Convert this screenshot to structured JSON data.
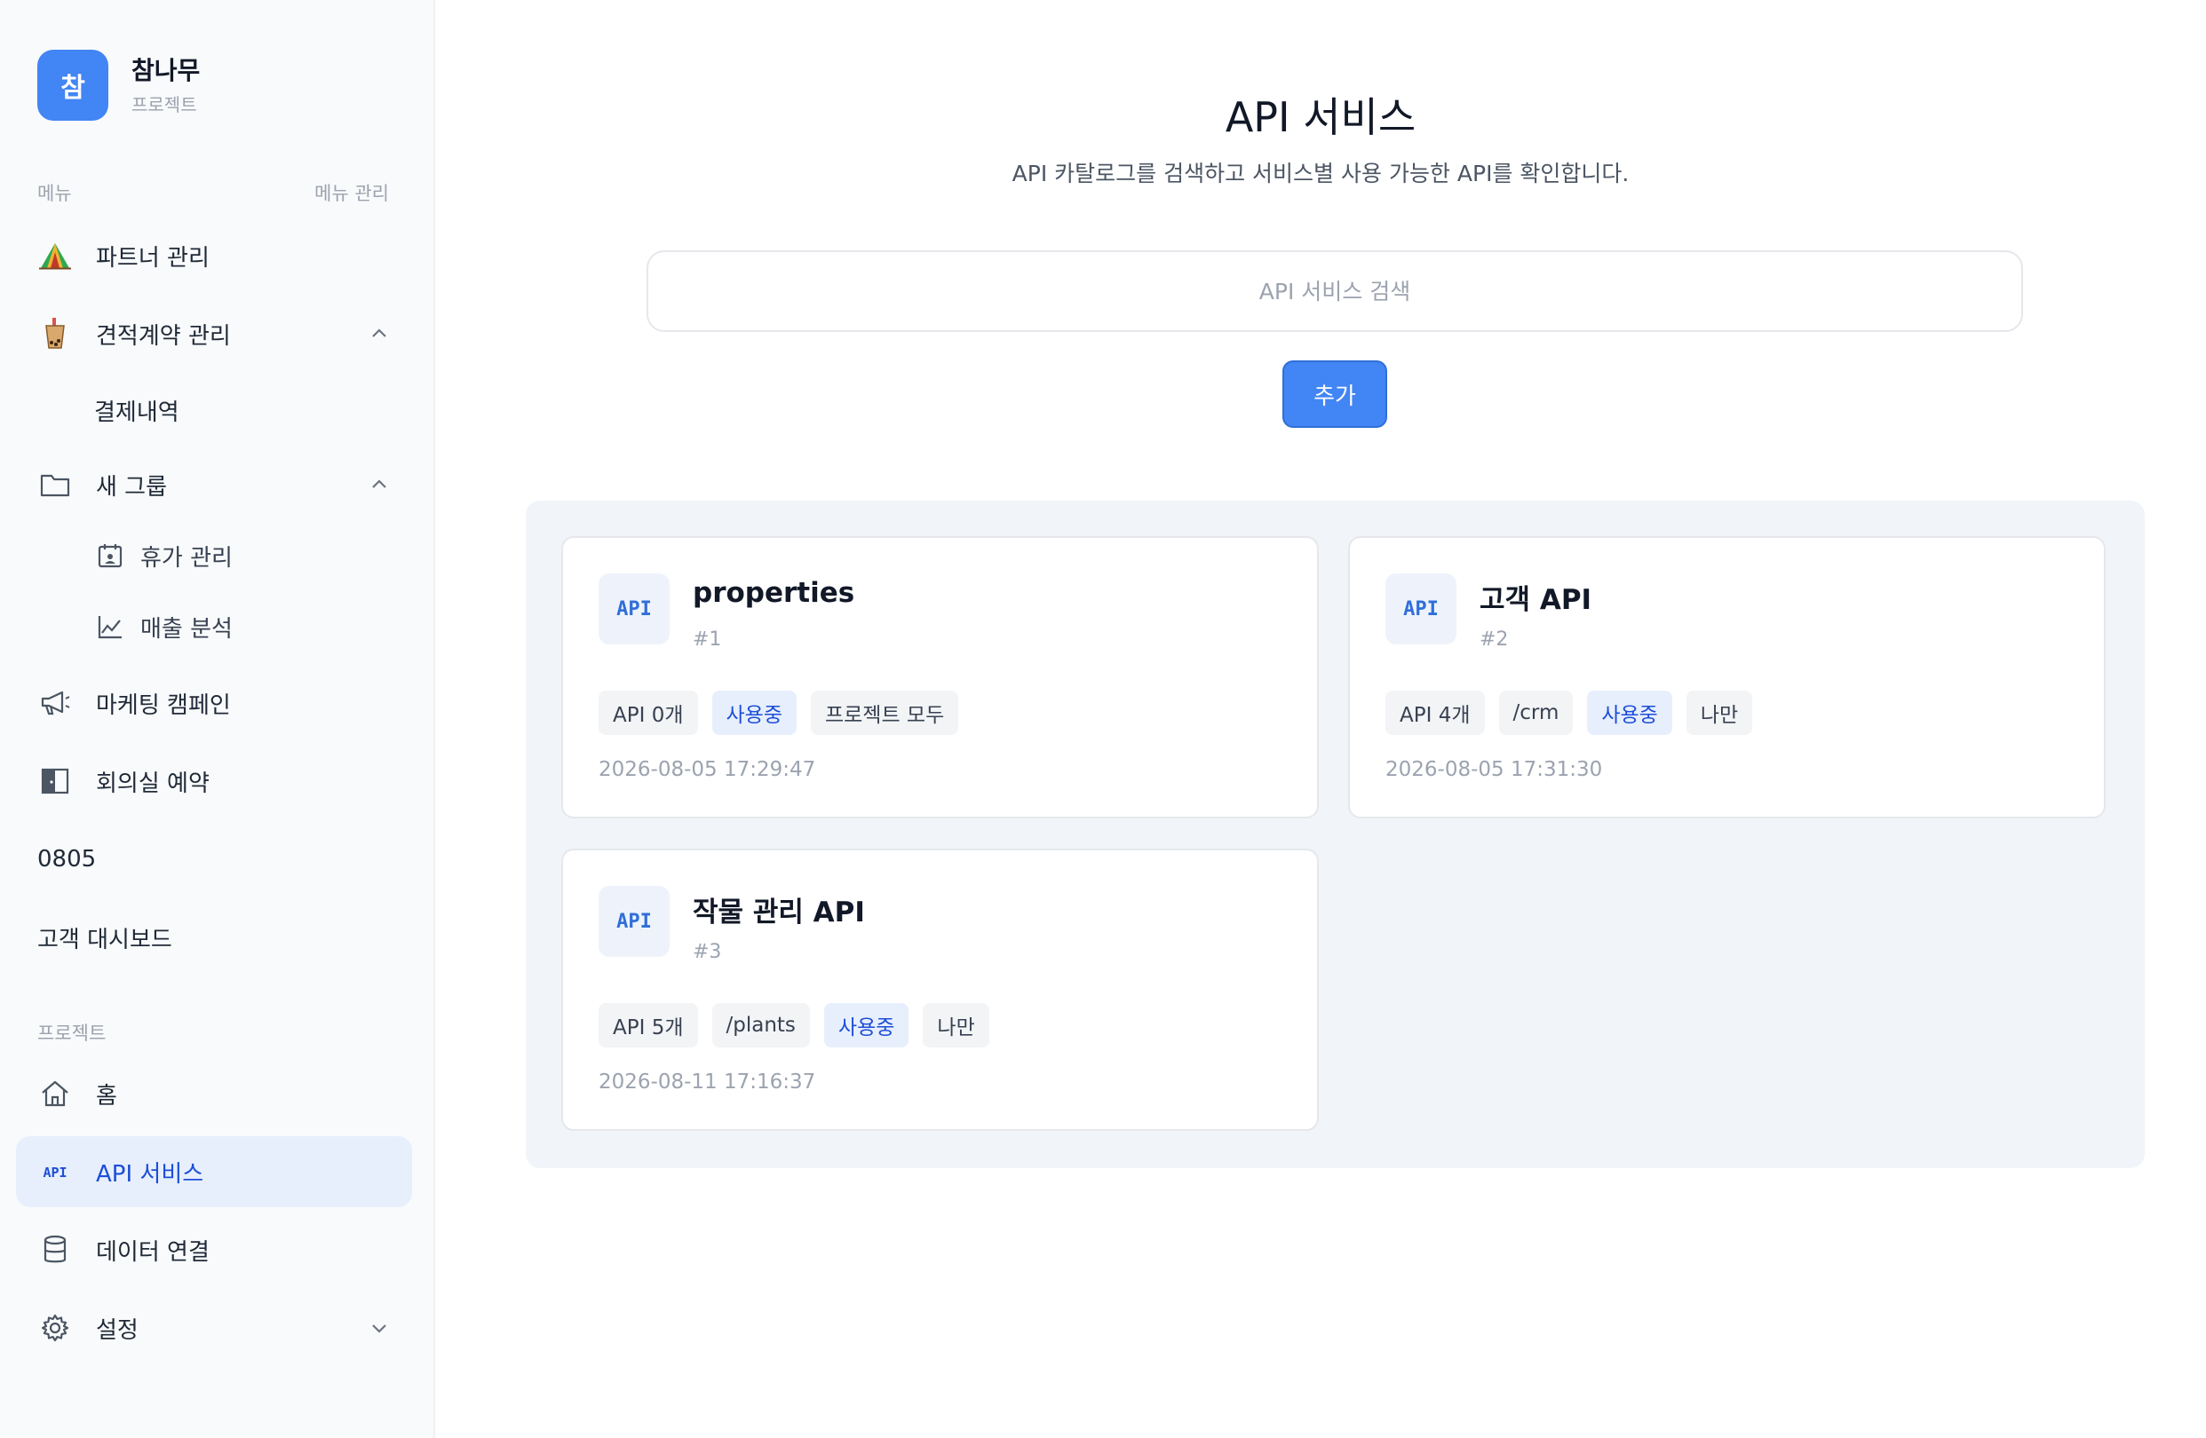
{
  "brand": {
    "logo": "참",
    "name": "참나무",
    "sub": "프로젝트"
  },
  "menu_section": {
    "label": "메뉴",
    "action": "메뉴 관리"
  },
  "menu": {
    "partner": "파트너 관리",
    "quote": "견적계약 관리",
    "payment": "결제내역",
    "group": "새 그룹",
    "vacation": "휴가 관리",
    "sales": "매출 분석",
    "marketing": "마케팅 캠페인",
    "meeting": "회의실 예약",
    "item_0805": "0805",
    "dashboard": "고객 대시보드"
  },
  "project_section": {
    "label": "프로젝트"
  },
  "project": {
    "home": "홈",
    "api": "API 서비스",
    "data": "데이터 연결",
    "settings": "설정"
  },
  "icons": {
    "partner": "tent-icon",
    "quote": "bubble-tea-icon",
    "group": "folder-icon",
    "vacation": "calendar-icon",
    "sales": "line-chart-icon",
    "marketing": "megaphone-icon",
    "meeting": "door-icon",
    "home": "home-icon",
    "api": "api-icon",
    "data": "database-icon",
    "settings": "gear-icon"
  },
  "main": {
    "title": "API 서비스",
    "subtitle": "API 카탈로그를 검색하고 서비스별 사용 가능한 API를 확인합니다.",
    "search_placeholder": "API 서비스 검색",
    "add_label": "추가"
  },
  "cards": [
    {
      "icon": "API",
      "title": "properties",
      "num": "#1",
      "tags": [
        "API 0개",
        "사용중",
        "프로젝트 모두"
      ],
      "date": "2026-08-05 17:29:47"
    },
    {
      "icon": "API",
      "title": "고객 API",
      "num": "#2",
      "tags": [
        "API 4개",
        "/crm",
        "사용중",
        "나만"
      ],
      "date": "2026-08-05 17:31:30"
    },
    {
      "icon": "API",
      "title": "작물 관리 API",
      "num": "#3",
      "tags": [
        "API 5개",
        "/plants",
        "사용중",
        "나만"
      ],
      "date": "2026-08-11 17:16:37"
    }
  ],
  "colors": {
    "accent": "#4285f4",
    "active_bg": "#e7effd",
    "active_text": "#1d4ed8",
    "panel_bg": "#f1f4f8"
  }
}
